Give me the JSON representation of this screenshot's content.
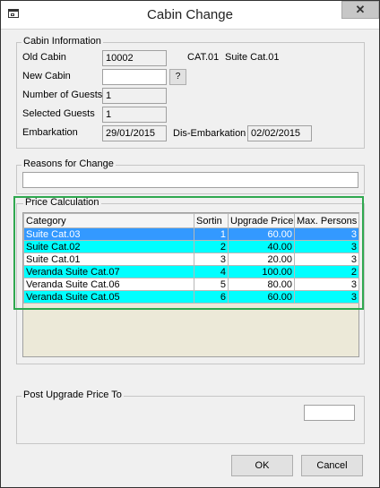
{
  "window": {
    "title": "Cabin Change",
    "close_glyph": "✕"
  },
  "cabin_info": {
    "legend": "Cabin Information",
    "old_cabin_label": "Old Cabin",
    "old_cabin_value": "10002",
    "old_cabin_category": "CAT.01",
    "old_cabin_category_name": "Suite Cat.01",
    "new_cabin_label": "New Cabin",
    "new_cabin_value": "",
    "lookup_button": "?",
    "guests_label": "Number of Guests",
    "guests_value": "1",
    "selected_label": "Selected Guests",
    "selected_value": "1",
    "embark_label": "Embarkation",
    "embark_value": "29/01/2015",
    "disembark_label": "Dis-Embarkation",
    "disembark_value": "02/02/2015"
  },
  "reasons": {
    "legend": "Reasons for Change",
    "value": ""
  },
  "price_calc": {
    "legend": "Price Calculation",
    "headers": [
      "Category",
      "Sortin",
      "Upgrade Price",
      "Max. Persons"
    ],
    "rows": [
      {
        "category": "Suite Cat.03",
        "sort": "1",
        "price": "60.00",
        "max": "3",
        "state": "selected"
      },
      {
        "category": "Suite Cat.02",
        "sort": "2",
        "price": "40.00",
        "max": "3",
        "state": "cyan"
      },
      {
        "category": "Suite Cat.01",
        "sort": "3",
        "price": "20.00",
        "max": "3",
        "state": "white"
      },
      {
        "category": "Veranda Suite Cat.07",
        "sort": "4",
        "price": "100.00",
        "max": "2",
        "state": "cyan"
      },
      {
        "category": "Veranda Suite Cat.06",
        "sort": "5",
        "price": "80.00",
        "max": "3",
        "state": "white"
      },
      {
        "category": "Veranda Suite Cat.05",
        "sort": "6",
        "price": "60.00",
        "max": "3",
        "state": "cyan"
      }
    ]
  },
  "post_upgrade": {
    "legend": "Post Upgrade Price To",
    "value": ""
  },
  "buttons": {
    "ok": "OK",
    "cancel": "Cancel"
  },
  "colors": {
    "selected_row": "#3399ff",
    "alt_row": "#00ffff",
    "highlight_border": "#2fa84f"
  }
}
